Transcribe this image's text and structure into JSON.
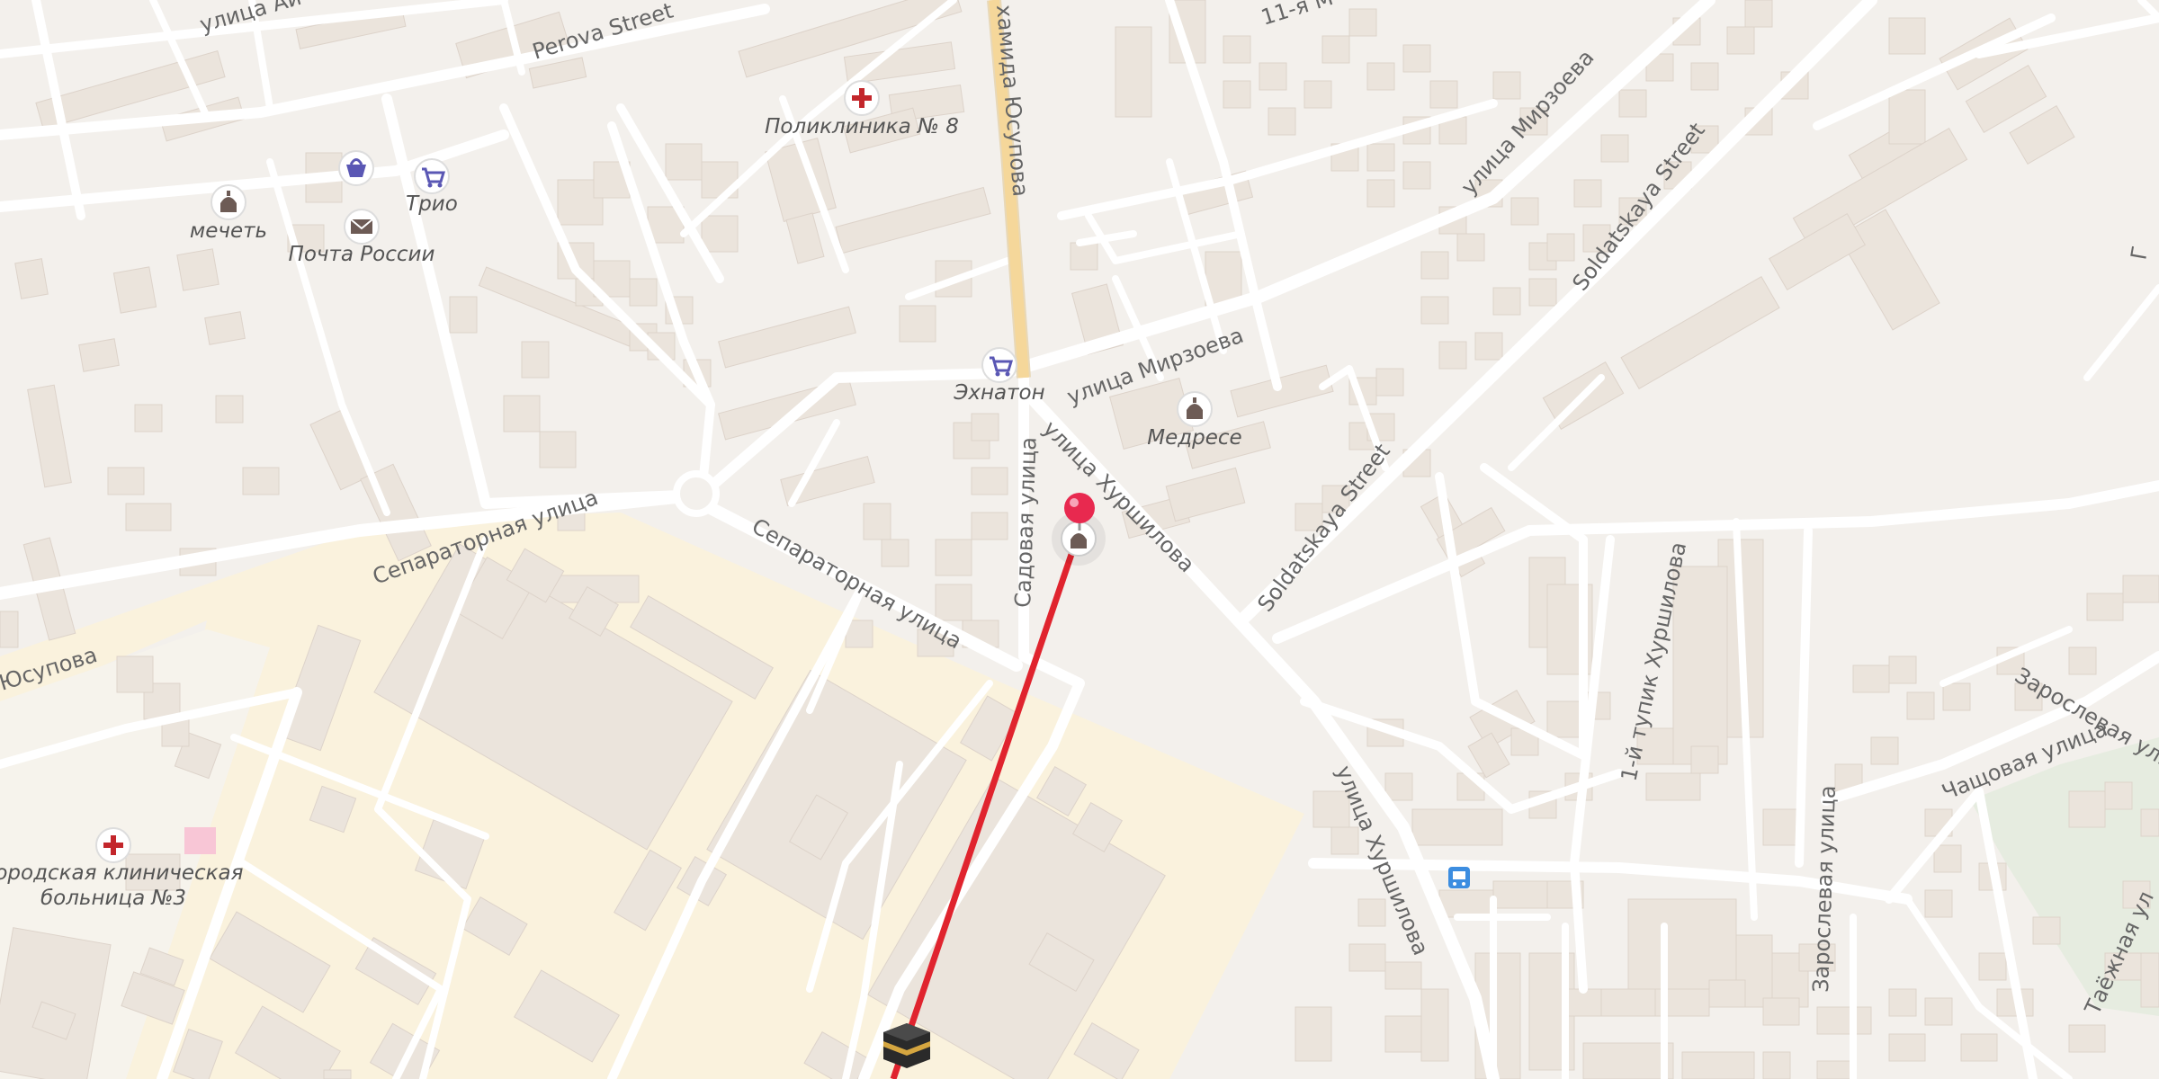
{
  "streets": {
    "yusupova_top": "хамида Юсупова",
    "perova": "Perova Street",
    "aina": "улица Ай",
    "m11": "11-я М",
    "mirzoeva_ne": "улица Мирзоева",
    "soldatskaya_n": "Soldatskaya Street",
    "mirzoeva": "улица Мирзоева",
    "khurshilova": "улица Хуршилова",
    "soldatskaya_s": "Soldatskaya Street",
    "sadovaya": "Садовая улица",
    "separatornaya_w": "Сепараторная улица",
    "separatornaya_e": "Сепараторная улица",
    "yusupova_w": "Юсупова",
    "tupik": "1-й тупик Хуршилова",
    "zaroslevaya": "Зарослевая улица",
    "chashchovaya": "Чащовая улица",
    "zaroslevaya_2": "Зарослевая улица",
    "khurshilova_s": "улица Хуршилова",
    "taezhnaya": "Таёжная ул",
    "cut_e": "Г"
  },
  "pois": {
    "polyclinic": "Поликлиника № 8",
    "mosque": "мечеть",
    "post": "Почта России",
    "trio": "Трио",
    "ekhnaton": "Эхнатон",
    "madrasa": "Медресе",
    "hospital_line1": "Городская клиническая",
    "hospital_line2": "больница №3"
  },
  "icons": {
    "polyclinic": "medical-cross-icon",
    "mosque": "mosque-icon",
    "post": "mail-envelope-icon",
    "shop_basket": "shopping-basket-icon",
    "trio": "shopping-cart-icon",
    "ekhnaton": "shopping-cart-icon",
    "madrasa": "mosque-icon",
    "hospital": "medical-cross-icon",
    "bus": "bus-stop-icon",
    "pin": "location-pin-icon",
    "kaaba": "kaaba-icon"
  },
  "colors": {
    "background": "#f3f0ec",
    "industrial_zone": "#faf2dd",
    "building": "#ebe4dc",
    "road": "#ffffff",
    "major_road": "#f5d79a",
    "qibla_line": "#e0242e",
    "pin": "#e8294f",
    "poi_icon": "#5a57b4",
    "medical": "#c3262b",
    "park": "#e6ece0"
  }
}
